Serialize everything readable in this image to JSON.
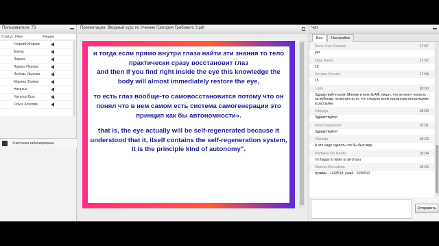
{
  "users_panel": {
    "title": "Пользователи: 73",
    "columns": [
      "Статус",
      "Имя",
      "Медиа"
    ],
    "users": [
      "Георгий Игоревич",
      "Елена",
      "Лариса",
      "Лариса Перова",
      "Любовь Якушкина",
      "Марина Зорина",
      "Наталья",
      "Наталья Бруг",
      "Ольга Хохлова"
    ],
    "footer_text": "Участники заблокированы"
  },
  "presentation": {
    "title": "Презентация: Вводный курс по Учению Григория Грабового 3.pdf",
    "slide": {
      "ru1": "и тогда если прямо внутри глаза найти эти знания то тело практически сразу восстановит глаз",
      "en1": "and then if you find right inside the eye this knowledge the body will almost immediately restore the eye,",
      "ru2": "то есть глаз вообще-то самовосстановится потому что он понял что в нем самом есть система самогенерации это принцип как бы автономности».",
      "en2": "that is, the eye actually will be self-regenerated because it understood that it, itself contains the self-regeneration system, it is the principle kind of autonomy\"."
    }
  },
  "chat": {
    "title": "Чат",
    "tabs": [
      "Все",
      "Настройки"
    ],
    "messages": [
      {
        "author": "Anne Lise Kvaavik",
        "time": "17:57",
        "text": "yes"
      },
      {
        "author": "Olga Alevn.",
        "time": "17:57",
        "text": "15"
      },
      {
        "author": "Renata Pereira",
        "time": "17:58",
        "text": "15"
      },
      {
        "author": "Luda",
        "time": "18:00",
        "text": "Здравствуйте всем! Многие в чате GrAffl. пишут, что не могут попасть на вебинар, несмотря на то, что следуют всем указанным инструкциям в рассылке."
      },
      {
        "author": "Viktorija",
        "time": "18:00",
        "text": "Здравствуйте!"
      },
      {
        "author": "Flora Bayanova",
        "time": "18:01",
        "text": "Здравствуйте!"
      },
      {
        "author": "Viktorija",
        "time": "18:02",
        "text": "А что надо сделать что бы был звук,"
      },
      {
        "author": "Raffaela De Nardo",
        "time": "18:04",
        "text": "I'm happy to listen to all of you"
      },
      {
        "author": "Marina Morozkina",
        "time": "18:06",
        "text": "травмы - 1418518; ушиб - 0156912"
      }
    ],
    "send_label": "Отправить"
  }
}
